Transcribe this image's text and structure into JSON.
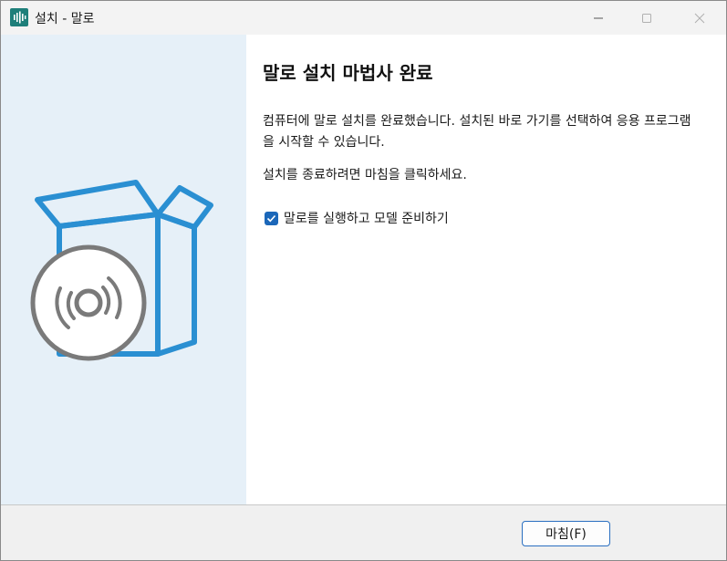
{
  "window": {
    "title": "설치 - 말로"
  },
  "main": {
    "heading": "말로 설치 마법사 완료",
    "paragraph1": "컴퓨터에 말로 설치를 완료했습니다. 설치된 바로 가기를 선택하여 응용 프로그램을 시작할 수 있습니다.",
    "paragraph2": "설치를 종료하려면 마침을 클릭하세요.",
    "checkbox": {
      "label": "말로를 실행하고 모델 준비하기",
      "checked": true
    }
  },
  "footer": {
    "finish_label": "마침(F)"
  },
  "colors": {
    "accent": "#1b67b9",
    "box_blue": "#2a8fd2",
    "disc_gray": "#7a7a7a",
    "side_bg": "#e6f0f8"
  }
}
